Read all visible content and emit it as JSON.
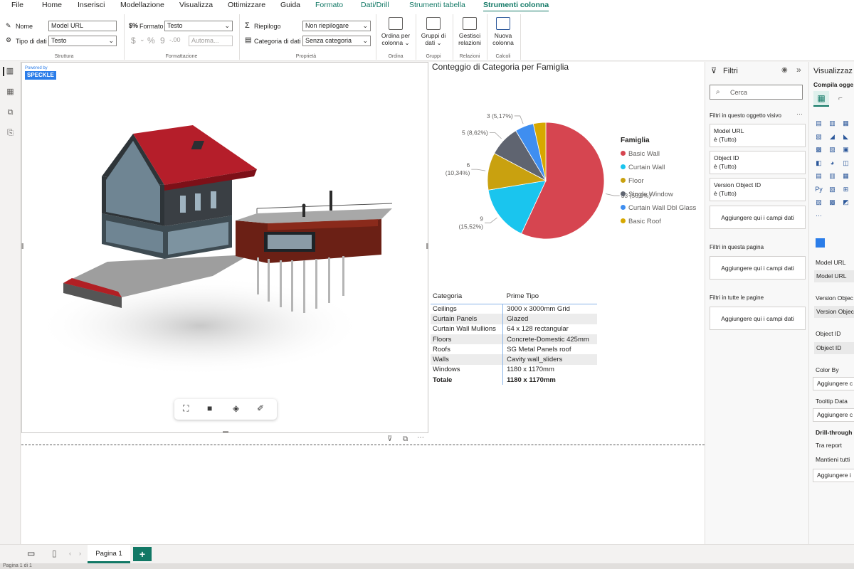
{
  "menu": {
    "tabs": [
      "File",
      "Home",
      "Inserisci",
      "Modellazione",
      "Visualizza",
      "Ottimizzare",
      "Guida",
      "Formato",
      "Dati/Drill",
      "Strumenti tabella",
      "Strumenti colonna"
    ]
  },
  "ribbon": {
    "struttura": {
      "name_label": "Nome",
      "name_value": "Model URL",
      "type_label": "Tipo di dati",
      "type_value": "Testo",
      "caption": "Struttura"
    },
    "formattazione": {
      "format_label": "Formato",
      "format_value": "Testo",
      "currency": "$",
      "percent": "%",
      "comma": "9",
      "decimals": "-.00",
      "auto": "Automa...",
      "caption": "Formattazione"
    },
    "proprieta": {
      "summary_label": "Riepilogo",
      "summary_value": "Non riepilogare",
      "category_label": "Categoria di dati",
      "category_value": "Senza categoria",
      "caption": "Proprietà"
    },
    "sort": {
      "label": "Ordina per colonna",
      "caption": "Ordina"
    },
    "groups": {
      "label": "Gruppi di dati",
      "caption": "Gruppi"
    },
    "relations": {
      "label": "Gestisci relazioni",
      "caption": "Relazioni"
    },
    "calc": {
      "label": "Nuova colonna",
      "caption": "Calcoli"
    }
  },
  "speckle": {
    "powered": "Powered by",
    "brand": "SPECKLE"
  },
  "chart_data": {
    "type": "pie",
    "title": "Conteggio di Categoria per Famiglia",
    "legend_title": "Famiglia",
    "legend_position": "right",
    "slices": [
      {
        "name": "Basic Wall",
        "value": 33,
        "label": "33 (56,9%)",
        "color": "#d64550"
      },
      {
        "name": "Curtain Wall",
        "value": 9,
        "label": "9 (15,52%)",
        "color": "#1ac5ee"
      },
      {
        "name": "Floor",
        "value": 6,
        "label": "6 (10,34%)",
        "color": "#c9a10f"
      },
      {
        "name": "Single Window",
        "value": 5,
        "label": "5 (8,62%)",
        "color": "#5f6470"
      },
      {
        "name": "Curtain Wall Dbl Glass",
        "value": 3,
        "label": "3 (5,17%)",
        "color": "#3f8ef0"
      },
      {
        "name": "Basic Roof",
        "value": 2,
        "label": "",
        "color": "#d7a800"
      }
    ]
  },
  "table": {
    "headers": [
      "Categoria",
      "Prime Tipo"
    ],
    "rows": [
      [
        "Ceilings",
        "3000 x 3000mm Grid"
      ],
      [
        "Curtain Panels",
        "Glazed"
      ],
      [
        "Curtain Wall Mullions",
        "64 x 128 rectangular"
      ],
      [
        "Floors",
        "Concrete-Domestic 425mm"
      ],
      [
        "Roofs",
        "SG Metal Panels roof"
      ],
      [
        "Walls",
        "Cavity wall_sliders"
      ],
      [
        "Windows",
        "1180 x 1170mm"
      ]
    ],
    "total": [
      "Totale",
      "1180 x 1170mm"
    ]
  },
  "filters": {
    "title": "Filtri",
    "search_placeholder": "Cerca",
    "visual_section": "Filtri in questo oggetto visivo",
    "cards": [
      {
        "name": "Model URL",
        "value": "è (Tutto)"
      },
      {
        "name": "Object ID",
        "value": "è (Tutto)"
      },
      {
        "name": "Version Object ID",
        "value": "è (Tutto)"
      }
    ],
    "add_fields": "Aggiungere qui i campi dati",
    "page_section": "Filtri in questa pagina",
    "all_pages_section": "Filtri in tutte le pagine"
  },
  "viz": {
    "title": "Visualizzaz",
    "subtitle": "Compila ogge",
    "model_url_label": "Model URL",
    "model_url_value": "Model URL",
    "version_label": "Version Objec",
    "version_value": "Version Objec",
    "object_label": "Object ID",
    "object_value": "Object ID",
    "color_label": "Color By",
    "color_well": "Aggiungere c",
    "tooltip_label": "Tooltip Data",
    "tooltip_well": "Aggiungere c",
    "drill_label": "Drill-through",
    "tra_report": "Tra report",
    "mantieni": "Mantieni tutti",
    "drill_well": "Aggiungere i"
  },
  "pages": {
    "tabs": [
      "Pagina 1"
    ],
    "add": "+"
  },
  "status": {
    "text": "Pagina 1 di 1"
  }
}
